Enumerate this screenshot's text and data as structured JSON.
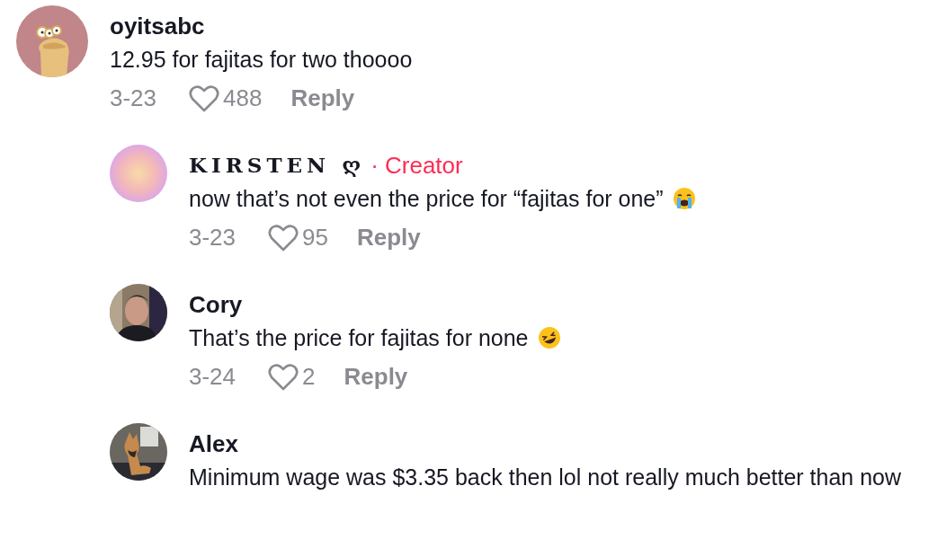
{
  "comments": [
    {
      "kind": "comment",
      "author": "oyitsabc",
      "avatar": {
        "kind": "illustration"
      },
      "text": "12.95 for fajitas for two thoooo",
      "date": "3-23",
      "likes": "488",
      "reply": "Reply"
    },
    {
      "kind": "creator_reply",
      "author": "KIRSTEN ღ",
      "badge": "· Creator",
      "avatar": {
        "kind": "gradient"
      },
      "text": "now that’s not even the price for “fajitas for one”",
      "emoji": {
        "kind": "crying"
      },
      "date": "3-23",
      "likes": "95",
      "reply": "Reply"
    },
    {
      "kind": "reply",
      "author": "Cory",
      "text": "That’s the price for fajitas for none",
      "emoji": {
        "kind": "laughing"
      },
      "date": "3-24",
      "likes": "2",
      "reply": "Reply"
    },
    {
      "kind": "reply",
      "author": "Alex",
      "text": "Minimum wage was $3.35 back then lol not really much better than now"
    }
  ]
}
